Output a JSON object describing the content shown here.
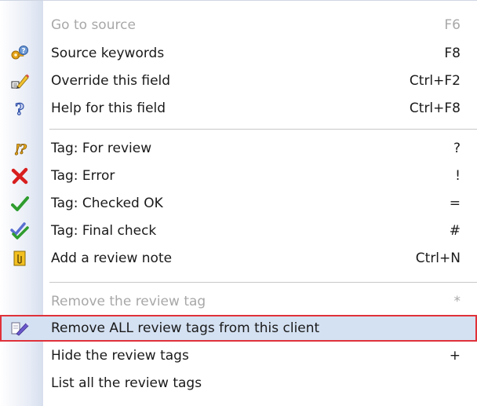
{
  "menu": {
    "items": [
      {
        "label": "Go to source",
        "shortcut": "F6",
        "icon": "none",
        "disabled": true
      },
      {
        "label": "Source keywords",
        "shortcut": "F8",
        "icon": "keys-question-icon"
      },
      {
        "label": "Override this field",
        "shortcut": "Ctrl+F2",
        "icon": "override-pencil-icon"
      },
      {
        "label": "Help for this field",
        "shortcut": "Ctrl+F8",
        "icon": "help-question-icon"
      },
      {
        "label": "Tag: For review",
        "shortcut": "?",
        "icon": "tag-review-icon"
      },
      {
        "label": "Tag: Error",
        "shortcut": "!",
        "icon": "tag-error-icon"
      },
      {
        "label": "Tag: Checked OK",
        "shortcut": "=",
        "icon": "tag-checked-icon"
      },
      {
        "label": "Tag: Final check",
        "shortcut": "#",
        "icon": "tag-final-check-icon"
      },
      {
        "label": "Add a review note",
        "shortcut": "Ctrl+N",
        "icon": "review-note-icon"
      },
      {
        "label": "Remove the review tag",
        "shortcut": "*",
        "icon": "none",
        "disabled": true
      },
      {
        "label": "Remove ALL review tags from this client",
        "shortcut": "",
        "icon": "remove-all-tags-icon",
        "highlighted": true
      },
      {
        "label": "Hide the review tags",
        "shortcut": "+",
        "icon": "none"
      },
      {
        "label": "List all the review tags",
        "shortcut": "",
        "icon": "none"
      }
    ]
  },
  "colors": {
    "highlight_bg": "#d4e1f2",
    "highlight_border": "#e0313a",
    "disabled_text": "#a8a8a8",
    "text": "#1a1a1a"
  }
}
